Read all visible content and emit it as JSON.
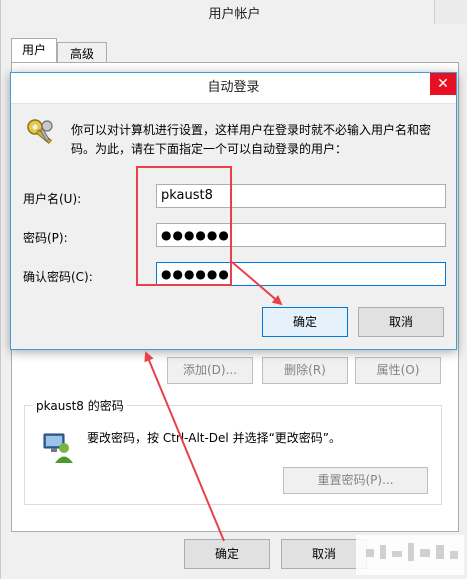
{
  "outer": {
    "title": "用户帐户",
    "tabs": [
      "用户",
      "高级"
    ],
    "buttons": {
      "add": "添加(D)...",
      "remove": "删除(R)",
      "properties": "属性(O)"
    },
    "password_group": {
      "title": "pkaust8 的密码",
      "text": "要改密码，按 Ctrl-Alt-Del 并选择“更改密码”。",
      "reset_button": "重置密码(P)..."
    },
    "ok": "确定",
    "cancel": "取消"
  },
  "dialog": {
    "title": "自动登录",
    "close_glyph": "✕",
    "description": "你可以对计算机进行设置，这样用户在登录时就不必输入用户名和密码。为此，请在下面指定一个可以自动登录的用户：",
    "fields": {
      "username_label": "用户名(U):",
      "username_value": "pkaust8",
      "password_label": "密码(P):",
      "password_value": "●●●●●●",
      "confirm_label": "确认密码(C):",
      "confirm_value": "●●●●●●"
    },
    "ok": "确定",
    "cancel": "取消"
  },
  "icons": {
    "dialog": "keys-icon",
    "password_group": "user-icon"
  },
  "colors": {
    "annotation": "#e8414b",
    "focus": "#0078d7",
    "close": "#e81123"
  }
}
